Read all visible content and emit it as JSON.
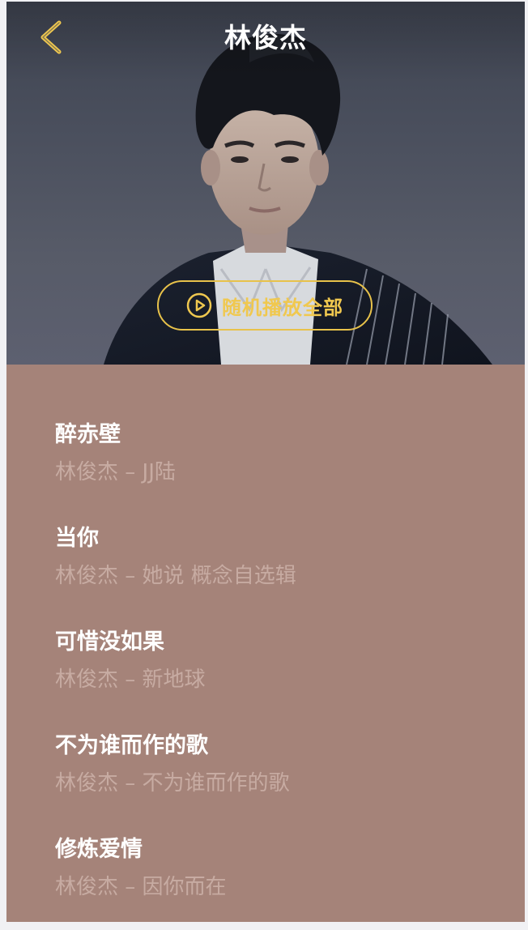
{
  "header": {
    "title": "林俊杰",
    "back_icon": "chevron-left-icon",
    "accent_color": "#f0c84f"
  },
  "hero": {
    "play_all_label": "随机播放全部",
    "play_icon": "play-circle-icon"
  },
  "songs": [
    {
      "name": "醉赤壁",
      "meta": "林俊杰 – JJ陆"
    },
    {
      "name": "当你",
      "meta": "林俊杰 – 她说 概念自选辑"
    },
    {
      "name": "可惜没如果",
      "meta": "林俊杰 – 新地球"
    },
    {
      "name": "不为谁而作的歌",
      "meta": "林俊杰 – 不为谁而作的歌"
    },
    {
      "name": "修炼爱情",
      "meta": "林俊杰 – 因你而在"
    }
  ],
  "colors": {
    "list_background": "#a58379",
    "song_title": "#ffffff",
    "song_meta": "#c7aba2"
  }
}
